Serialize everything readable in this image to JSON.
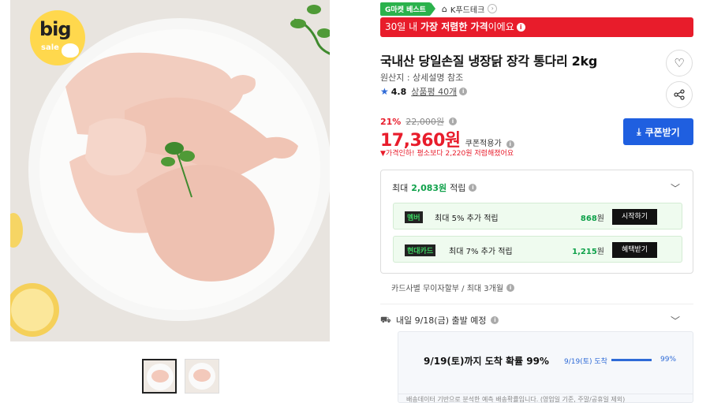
{
  "gallery": {
    "sale_badge_big": "big",
    "sale_badge_small": "sale"
  },
  "badges": {
    "gmarket_best": "G마켓 베스트",
    "store_name": "K푸드테크"
  },
  "lowest_banner": {
    "prefix": "30일 내 ",
    "bold": "가장 저렴한 가격",
    "suffix": "이에요"
  },
  "product": {
    "title": "국내산 당일손질 냉장닭 장각 통다리 2kg",
    "origin": "원산지 : 상세설명 참조",
    "rating": "4.8",
    "reviews": "상품평 40개"
  },
  "price": {
    "discount_pct": "21%",
    "original": "22,000원",
    "final": "17,360원",
    "coupon_note": "쿠폰적용가",
    "drop_note": "가격인하! 평소보다 2,220원 저렴해졌어요",
    "coupon_button": "쿠폰받기"
  },
  "points": {
    "head_prefix": "최대 ",
    "head_amount": "2,083원",
    "head_suffix": " 적립",
    "rows": [
      {
        "logo": "멤버",
        "desc": "최대 5% 추가 적립",
        "amount": "868",
        "unit": "원",
        "action": "시작하기"
      },
      {
        "logo": "현대카드",
        "desc": "최대 7% 추가 적립",
        "amount": "1,215",
        "unit": "원",
        "action": "혜택받기"
      }
    ]
  },
  "installment": "카드사별 무이자할부 / 최대 3개월",
  "shipping": {
    "depart": "내일 9/18(금) 출발 예정",
    "arrival_prob": "9/19(토)까지 도착 확률 99%",
    "date_label": "9/19(토) 도착",
    "pct_label": "99%",
    "pct_value": 0.99,
    "note": "배송데이터 기반으로 분석한 예측 배송확률입니다. (영업일 기준, 주말/공휴일 제외)"
  },
  "colors": {
    "accent_red": "#e81c2b",
    "button_blue": "#1f5fe0",
    "point_green": "#0fa14a"
  }
}
